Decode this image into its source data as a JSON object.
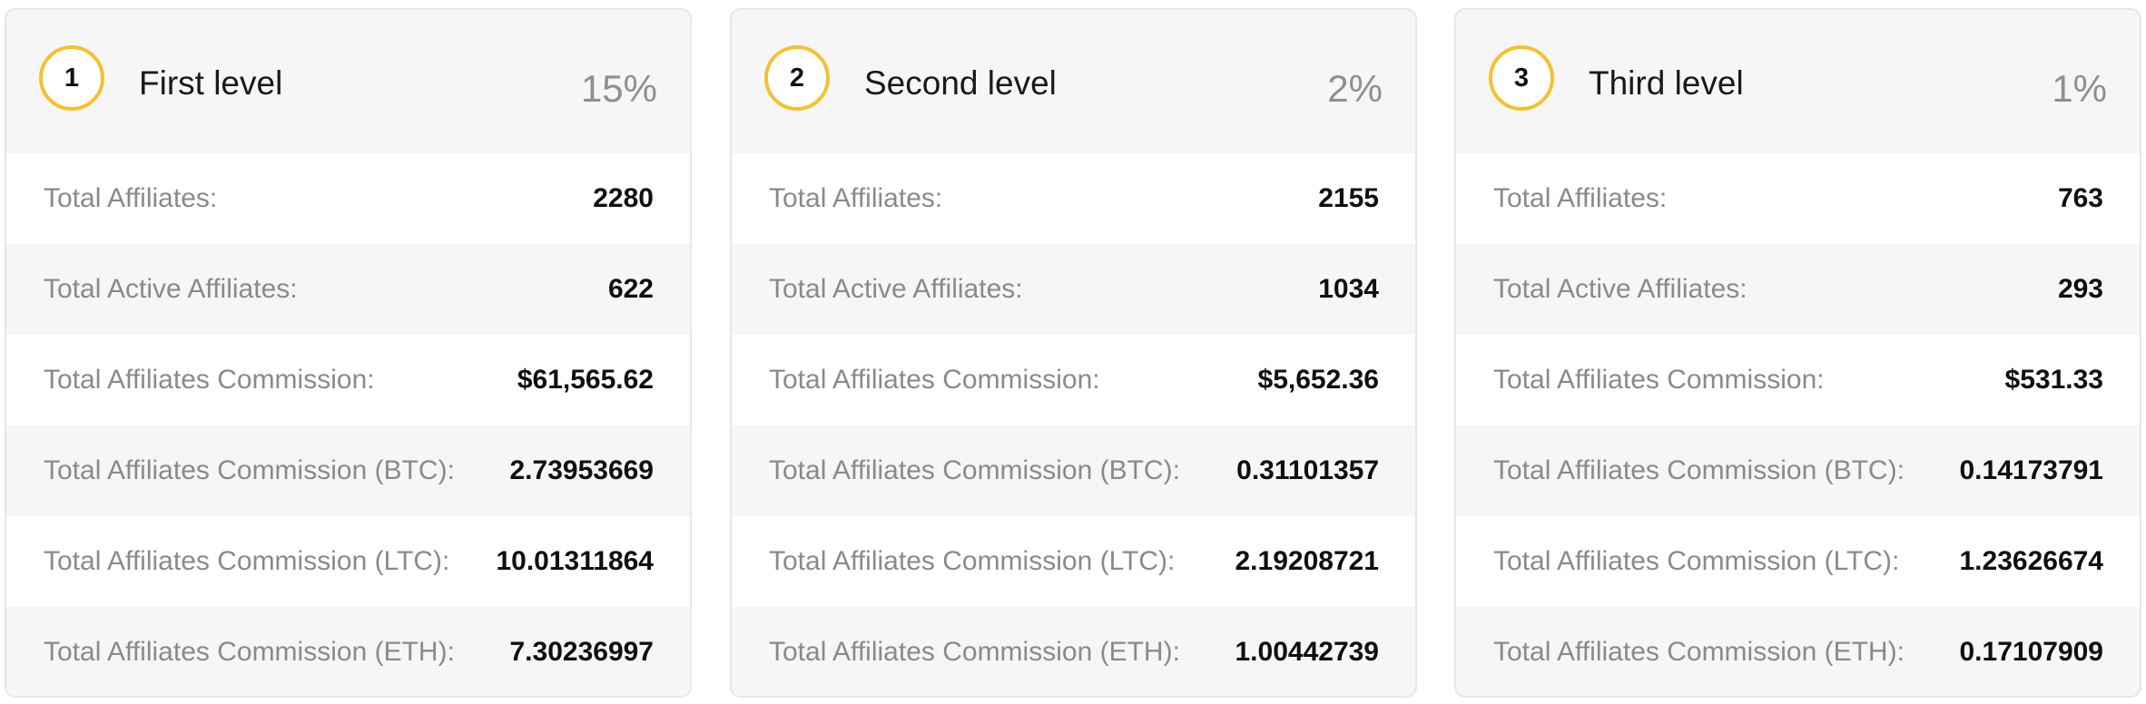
{
  "levels": [
    {
      "number": "1",
      "title": "First level",
      "percent": "15%",
      "stats": [
        {
          "label": "Total Affiliates:",
          "value": "2280"
        },
        {
          "label": "Total Active Affiliates:",
          "value": "622"
        },
        {
          "label": "Total Affiliates Commission:",
          "value": "$61,565.62"
        },
        {
          "label": "Total Affiliates Commission (BTC):",
          "value": "2.73953669"
        },
        {
          "label": "Total Affiliates Commission (LTC):",
          "value": "10.01311864"
        },
        {
          "label": "Total Affiliates Commission (ETH):",
          "value": "7.30236997"
        }
      ]
    },
    {
      "number": "2",
      "title": "Second level",
      "percent": "2%",
      "stats": [
        {
          "label": "Total Affiliates:",
          "value": "2155"
        },
        {
          "label": "Total Active Affiliates:",
          "value": "1034"
        },
        {
          "label": "Total Affiliates Commission:",
          "value": "$5,652.36"
        },
        {
          "label": "Total Affiliates Commission (BTC):",
          "value": "0.31101357"
        },
        {
          "label": "Total Affiliates Commission (LTC):",
          "value": "2.19208721"
        },
        {
          "label": "Total Affiliates Commission (ETH):",
          "value": "1.00442739"
        }
      ]
    },
    {
      "number": "3",
      "title": "Third level",
      "percent": "1%",
      "stats": [
        {
          "label": "Total Affiliates:",
          "value": "763"
        },
        {
          "label": "Total Active Affiliates:",
          "value": "293"
        },
        {
          "label": "Total Affiliates Commission:",
          "value": "$531.33"
        },
        {
          "label": "Total Affiliates Commission (BTC):",
          "value": "0.14173791"
        },
        {
          "label": "Total Affiliates Commission (LTC):",
          "value": "1.23626674"
        },
        {
          "label": "Total Affiliates Commission (ETH):",
          "value": "0.17107909"
        }
      ]
    }
  ],
  "colors": {
    "badge_border": "#f1c232",
    "header_bg": "#f6f6f6",
    "label_text": "#8a8a8a",
    "value_text": "#0f0f0f",
    "percent_text": "#8f8f8f"
  }
}
